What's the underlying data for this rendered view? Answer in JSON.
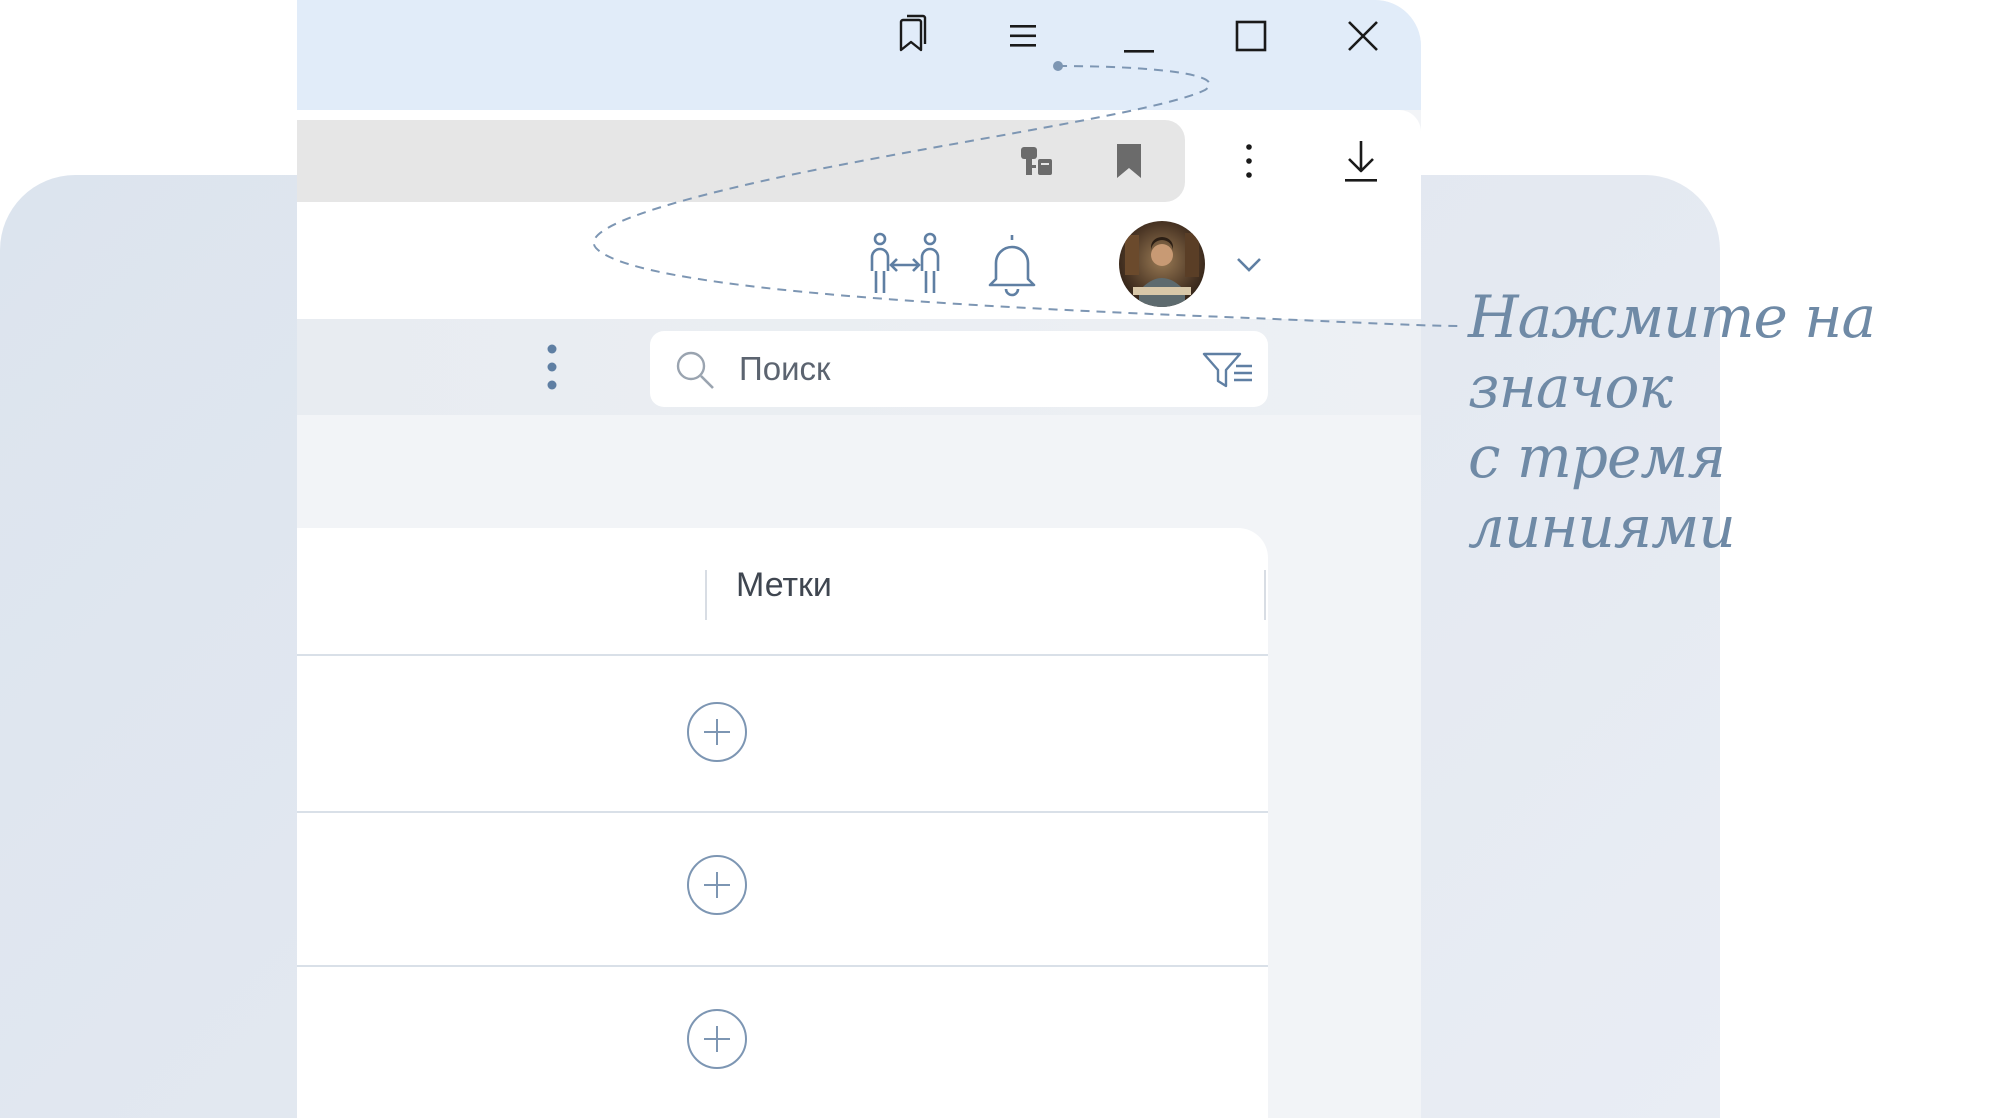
{
  "search": {
    "placeholder": "Поиск"
  },
  "table": {
    "column_header": "Метки",
    "add_buttons": [
      "+",
      "+",
      "+"
    ]
  },
  "hint": {
    "line1": "Нажмите на значок",
    "line2": "с тремя линиями"
  },
  "colors": {
    "titlebar": "#e1ecf9",
    "accent_line": "#7d96b3",
    "hint_text": "#6f8aa6",
    "background_panel": "#dce4ee"
  },
  "icons": {
    "titlebar": [
      "bookmarks-icon",
      "hamburger-menu-icon",
      "minimize-icon",
      "maximize-icon",
      "close-icon"
    ],
    "toolbar": [
      "password-key-icon",
      "bookmark-icon",
      "kebab-menu-icon",
      "download-icon"
    ],
    "header": [
      "people-exchange-icon",
      "bell-icon",
      "avatar",
      "chevron-down-icon"
    ],
    "filterbar": [
      "vertical-dots-icon",
      "search-icon",
      "filter-list-icon"
    ]
  }
}
